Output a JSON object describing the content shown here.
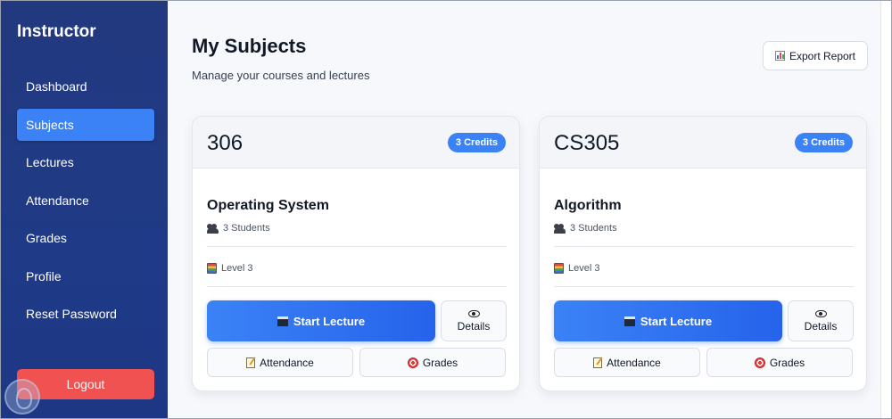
{
  "sidebar": {
    "brand": "Instructor",
    "items": [
      {
        "label": "Dashboard",
        "active": false
      },
      {
        "label": "Subjects",
        "active": true
      },
      {
        "label": "Lectures",
        "active": false
      },
      {
        "label": "Attendance",
        "active": false
      },
      {
        "label": "Grades",
        "active": false
      },
      {
        "label": "Profile",
        "active": false
      },
      {
        "label": "Reset Password",
        "active": false
      }
    ],
    "logout_label": "Logout"
  },
  "header": {
    "title": "My Subjects",
    "subtitle": "Manage your courses and lectures",
    "export_label": "Export Report"
  },
  "subjects": [
    {
      "code": "306",
      "credits": "3 Credits",
      "name": "Operating System",
      "students": "3 Students",
      "level": "Level 3",
      "start_label": "Start Lecture",
      "details_label": "Details",
      "attendance_label": "Attendance",
      "grades_label": "Grades"
    },
    {
      "code": "CS305",
      "credits": "3 Credits",
      "name": "Algorithm",
      "students": "3 Students",
      "level": "Level 3",
      "start_label": "Start Lecture",
      "details_label": "Details",
      "attendance_label": "Attendance",
      "grades_label": "Grades"
    }
  ],
  "colors": {
    "sidebar_bg": "#22397f",
    "accent": "#3b82f6",
    "logout": "#f05252"
  },
  "icons": {
    "export": "bar-chart-icon",
    "students": "users-icon",
    "level": "books-icon",
    "start": "clapper-icon",
    "details": "eye-icon",
    "attendance": "memo-icon",
    "grades": "target-icon"
  }
}
